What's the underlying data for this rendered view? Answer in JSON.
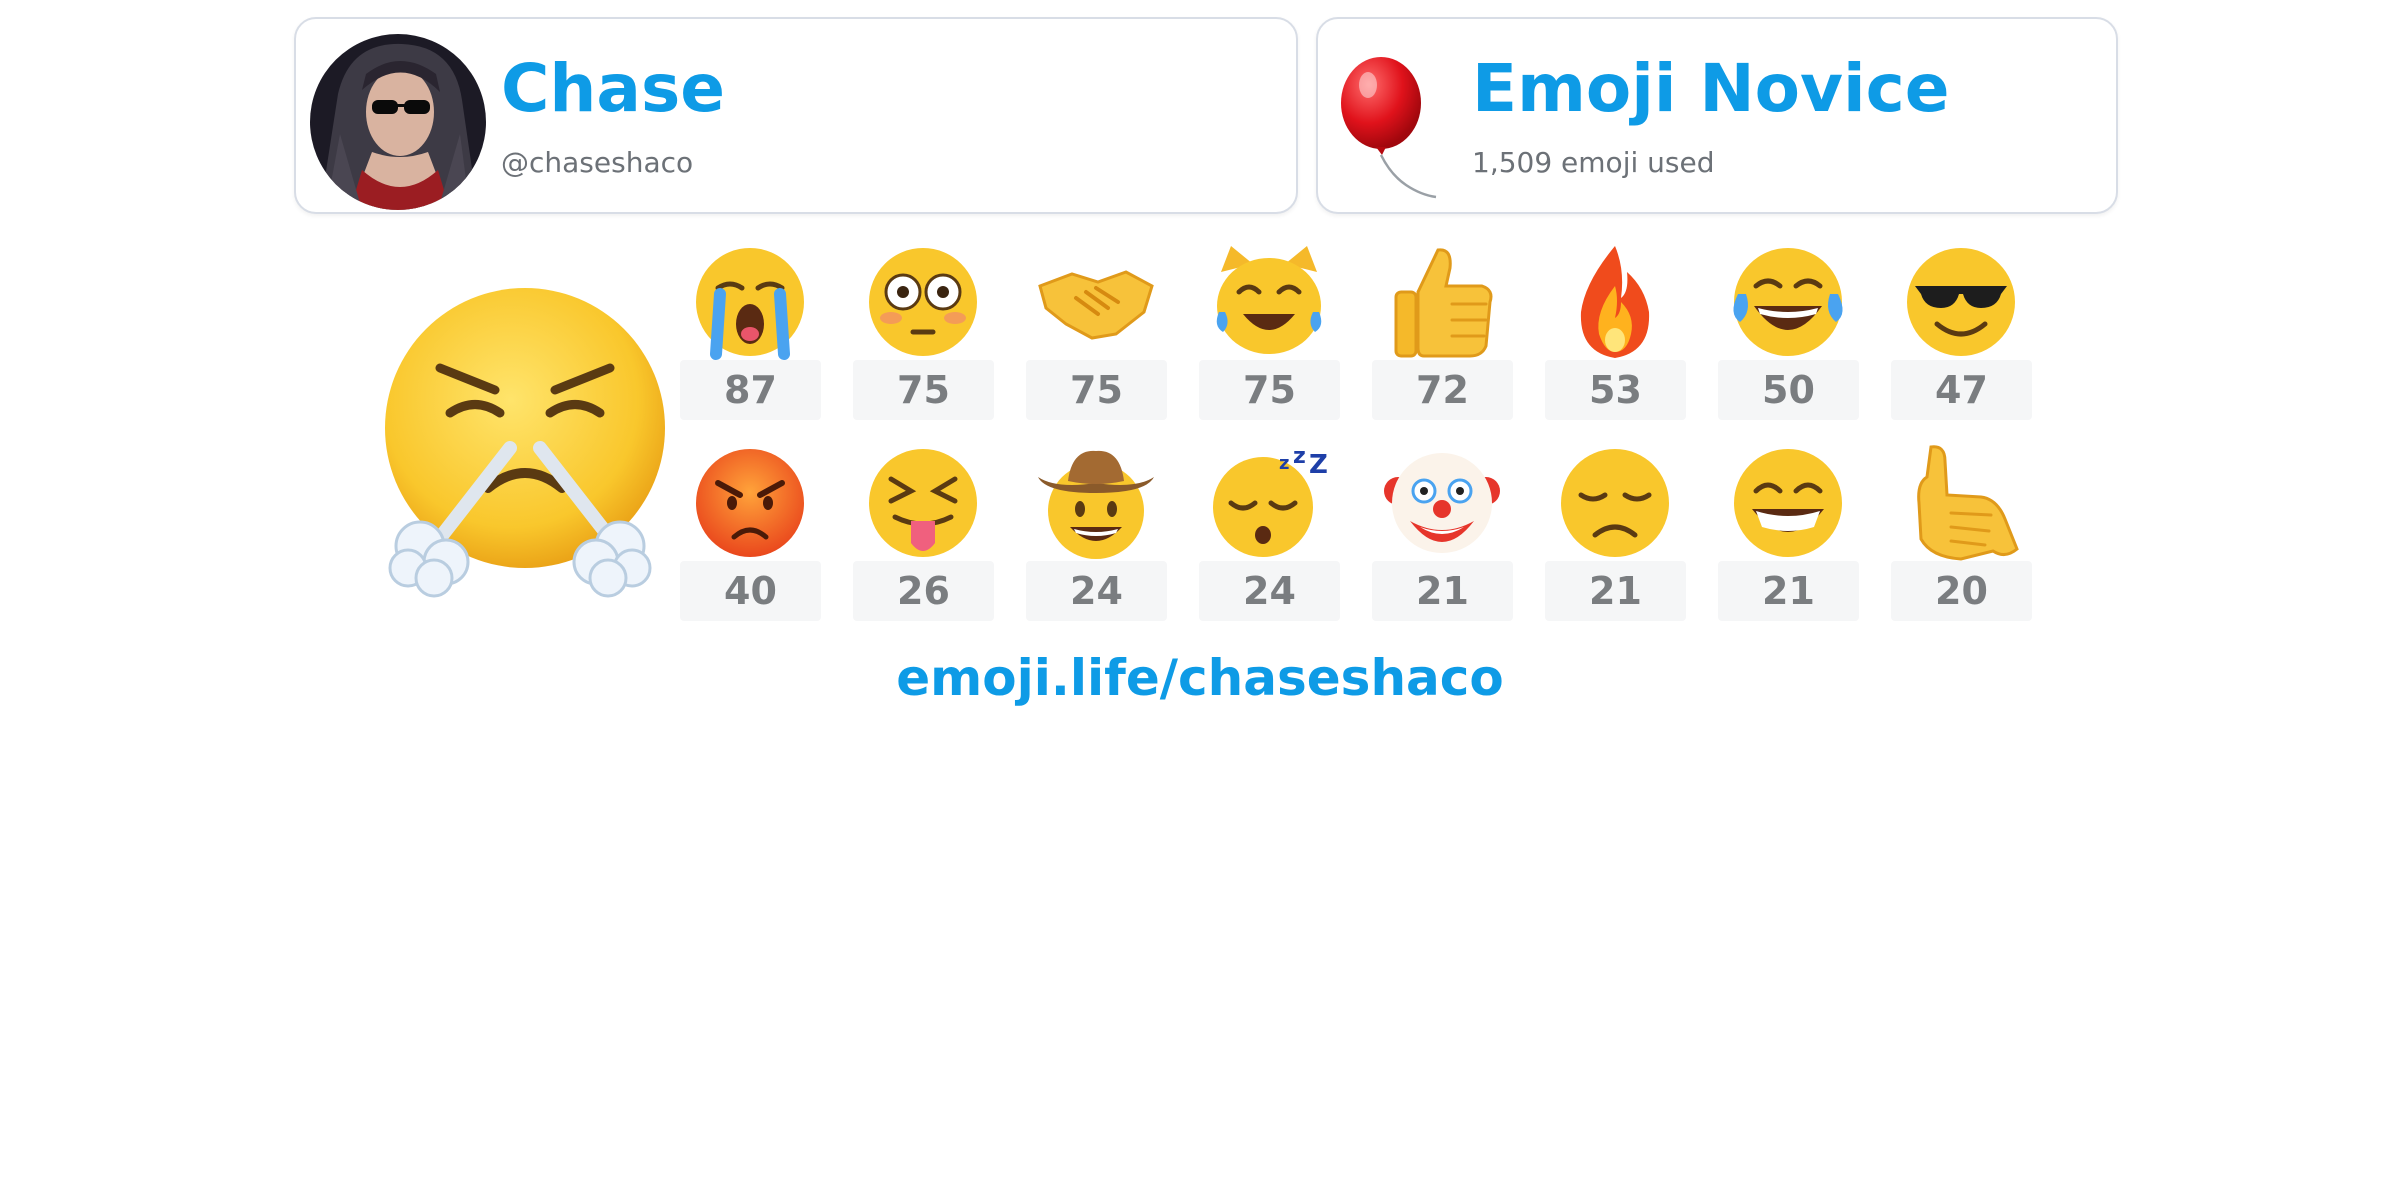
{
  "user": {
    "name": "Chase",
    "handle": "@chaseshaco"
  },
  "level": {
    "title": "Emoji Novice",
    "emoji_count": "1,509 emoji used",
    "icon": "balloon"
  },
  "top_emoji": {
    "icon": "face-with-steam-from-nose"
  },
  "emoji_stats": [
    {
      "icon": "loudly-crying-face",
      "count": "87"
    },
    {
      "icon": "flushed-face",
      "count": "75"
    },
    {
      "icon": "handshake",
      "count": "75"
    },
    {
      "icon": "cat-with-tears-of-joy",
      "count": "75"
    },
    {
      "icon": "thumbs-up",
      "count": "72"
    },
    {
      "icon": "fire",
      "count": "53"
    },
    {
      "icon": "face-with-tears-of-joy",
      "count": "50"
    },
    {
      "icon": "smiling-face-with-sunglasses",
      "count": "47"
    },
    {
      "icon": "pouting-face",
      "count": "40"
    },
    {
      "icon": "squinting-face-with-tongue",
      "count": "26"
    },
    {
      "icon": "cowboy-hat-face",
      "count": "24"
    },
    {
      "icon": "sleeping-face",
      "count": "24"
    },
    {
      "icon": "clown-face",
      "count": "21"
    },
    {
      "icon": "disappointed-face",
      "count": "21"
    },
    {
      "icon": "beaming-face-with-smiling-eyes",
      "count": "21"
    },
    {
      "icon": "call-me-hand",
      "count": "20"
    }
  ],
  "footer": {
    "link": "emoji.life/chaseshaco"
  },
  "colors": {
    "accent": "#0e9be6",
    "count_text": "#7a7d80",
    "count_bg": "#f5f6f7",
    "card_border": "#d8dde6"
  }
}
